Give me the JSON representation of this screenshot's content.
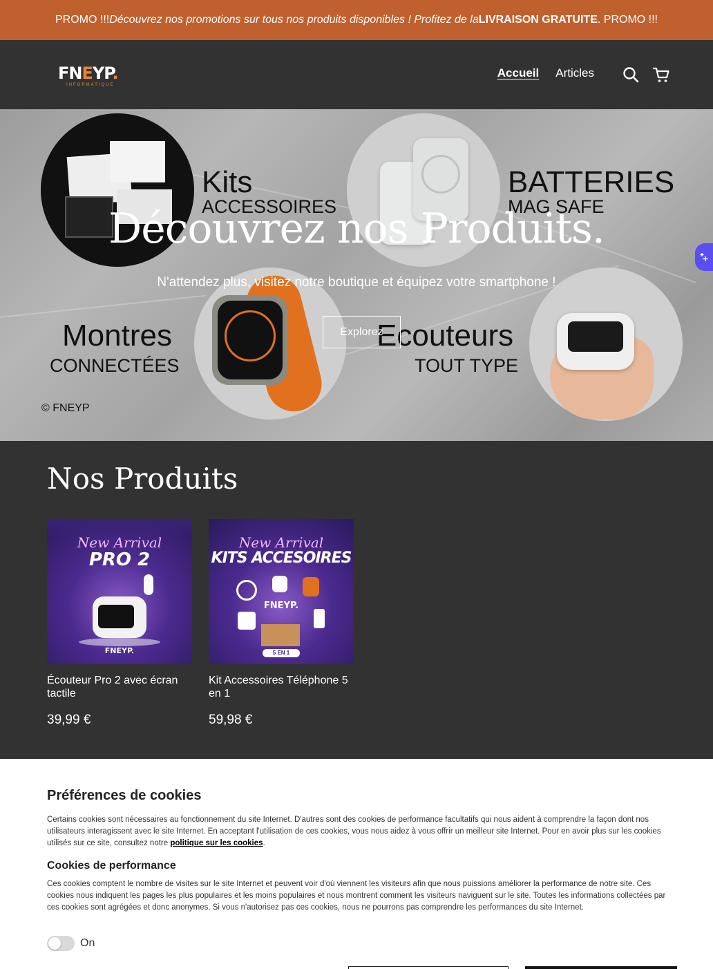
{
  "promo": {
    "prefix": "PROMO !!! ",
    "italic": "Découvrez nos promotions sur tous nos produits disponibles ! Profitez de la ",
    "bold": "LIVRAISON GRATUITE",
    "suffix": ". PROMO !!!"
  },
  "header": {
    "logo_main": "FNEYP.",
    "logo_sub": "INFORMATIQUE",
    "nav": [
      {
        "label": "Accueil",
        "active": true
      },
      {
        "label": "Articles",
        "active": false
      }
    ],
    "icons": [
      "search-icon",
      "cart-icon"
    ]
  },
  "hero": {
    "title": "Découvrez nos Produits.",
    "subtitle": "N'attendez plus, visitez notre boutique et équipez votre smartphone !",
    "button": "Explorez",
    "copyright": "© FNEYP",
    "deco": {
      "kits": "Kits",
      "accessoires": "ACCESSOIRES",
      "batteries": "BATTERIES",
      "magsafe": "MAG SAFE",
      "montres": "Montres",
      "connectees": "CONNECTÉES",
      "ecouteurs": "Ecouteurs",
      "tout_type": "TOUT TYPE"
    }
  },
  "products": {
    "title": "Nos Produits",
    "items": [
      {
        "name": "Écouteur Pro 2 avec écran tactile",
        "price": "39,99 €",
        "image_text": "New Arrival",
        "image_title": "PRO 2",
        "image_logo": "FNEYP."
      },
      {
        "name": "Kit Accessoires Téléphone 5 en 1",
        "price": "59,98 €",
        "image_text": "New Arrival",
        "image_title": "KITS ACCESOIRES",
        "image_logo": "FNEYP.",
        "image_badge": "5 EN 1"
      }
    ]
  },
  "cookies": {
    "title": "Préférences de cookies",
    "intro": "Certains cookies sont nécessaires au fonctionnement du site Internet. D'autres sont des cookies de performance facultatifs qui nous aident à comprendre la façon dont nos utilisateurs interagissent avec le site Internet. En acceptant l'utilisation de ces cookies, vous nous aidez à vous offrir un meilleur site Internet. Pour en avoir plus sur les cookies utilisés sur ce site, consultez notre ",
    "intro_link": "politique sur les cookies",
    "intro_end": ".",
    "perf_title": "Cookies de performance",
    "perf_text": "Ces cookies comptent le nombre de visites sur le site Internet et peuvent voir d'où viennent les visiteurs afin que nous puissions améliorer la performance de notre site. Ces cookies nous indiquent les pages les plus populaires et les moins populaires et nous montrent comment les visiteurs naviguent sur le site. Toutes les informations collectées par ces cookies sont agrégées et donc anonymes. Si vous n'autorisez pas ces cookies, nous ne pourrons pas comprendre les performances du site Internet.",
    "toggle_label": "On"
  },
  "colors": {
    "promo_bg": "#c0602e",
    "accent": "#e8862b",
    "dark_bg": "#323232",
    "assist": "#5b4ef0"
  }
}
